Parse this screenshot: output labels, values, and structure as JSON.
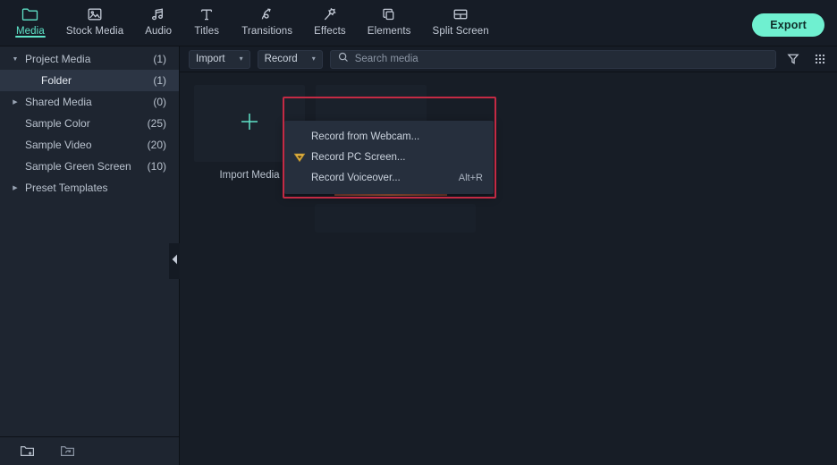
{
  "app": {
    "accent_teal": "#5fe3c8",
    "export_bg": "#6ff0d0",
    "annotation_red": "#c42a44",
    "sidebar_bg": "#1e2530",
    "main_bg": "#171d26"
  },
  "topbar": {
    "tabs": [
      {
        "label": "Media",
        "icon": "folder-icon",
        "active": true
      },
      {
        "label": "Stock Media",
        "icon": "image-icon",
        "active": false
      },
      {
        "label": "Audio",
        "icon": "music-note-icon",
        "active": false
      },
      {
        "label": "Titles",
        "icon": "text-t-icon",
        "active": false
      },
      {
        "label": "Transitions",
        "icon": "transition-arrow-icon",
        "active": false
      },
      {
        "label": "Effects",
        "icon": "magic-wand-icon",
        "active": false
      },
      {
        "label": "Elements",
        "icon": "shapes-icon",
        "active": false
      },
      {
        "label": "Split Screen",
        "icon": "split-screen-icon",
        "active": false
      }
    ],
    "export_label": "Export"
  },
  "sidebar": {
    "items": [
      {
        "label": "Project Media",
        "count": "(1)",
        "arrow": "down",
        "indent": false,
        "selected": false
      },
      {
        "label": "Folder",
        "count": "(1)",
        "arrow": "none",
        "indent": true,
        "selected": true
      },
      {
        "label": "Shared Media",
        "count": "(0)",
        "arrow": "right",
        "indent": false,
        "selected": false
      },
      {
        "label": "Sample Color",
        "count": "(25)",
        "arrow": "none",
        "indent": false,
        "selected": false
      },
      {
        "label": "Sample Video",
        "count": "(20)",
        "arrow": "none",
        "indent": false,
        "selected": false
      },
      {
        "label": "Sample Green Screen",
        "count": "(10)",
        "arrow": "none",
        "indent": false,
        "selected": false
      },
      {
        "label": "Preset Templates",
        "count": "",
        "arrow": "right",
        "indent": false,
        "selected": false
      }
    ],
    "footer": {
      "new_folder_icon": "new-folder-icon",
      "refresh_folder_icon": "refresh-folder-icon"
    },
    "collapse_icon": "collapse-left-icon"
  },
  "toolbar": {
    "import_label": "Import",
    "record_label": "Record",
    "search_placeholder": "Search media",
    "search_value": "",
    "search_icon": "search-icon",
    "filter_icon": "filter-funnel-icon",
    "grid_icon": "grid-view-icon"
  },
  "media": {
    "import_tile_label": "Import Media",
    "plus_icon": "plus-icon"
  },
  "record_menu": {
    "items": [
      {
        "label": "Record from Webcam...",
        "shortcut": "",
        "icon": "none"
      },
      {
        "label": "Record PC Screen...",
        "shortcut": "",
        "icon": "wondershare-badge-icon"
      },
      {
        "label": "Record Voiceover...",
        "shortcut": "Alt+R",
        "icon": "none"
      }
    ]
  }
}
